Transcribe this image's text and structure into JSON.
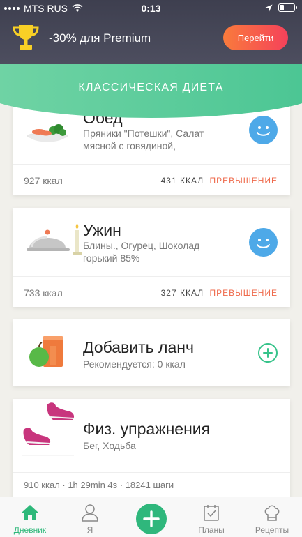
{
  "status": {
    "carrier": "MTS RUS",
    "time": "0:13"
  },
  "promo": {
    "text": "-30% для Premium",
    "button": "Перейти"
  },
  "header": {
    "title": "КЛАССИЧЕСКАЯ ДИЕТА"
  },
  "meals": [
    {
      "title": "Обед",
      "items": "Пряники \"Потешки\", Салат мясной с говядиной,",
      "kcal": "927 ккал",
      "over_value": "431 ККАЛ",
      "over_label": "ПРЕВЫШЕНИЕ"
    },
    {
      "title": "Ужин",
      "items": "Блины., Огурец, Шоколад горький 85%",
      "kcal": "733 ккал",
      "over_value": "327 ККАЛ",
      "over_label": "ПРЕВЫШЕНИЕ"
    }
  ],
  "lunch": {
    "title": "Добавить ланч",
    "recommend": "Рекомендуется: 0  ккал"
  },
  "exercise": {
    "title": "Физ. упражнения",
    "types": "Бег, Ходьба",
    "summary": "910 ккал · 1h 29min 4s  · 18241 шаги"
  },
  "tabs": [
    {
      "label": "Дневник",
      "icon": "home-icon",
      "active": true
    },
    {
      "label": "Я",
      "icon": "person-icon"
    },
    {
      "label": "",
      "icon": "plus-icon"
    },
    {
      "label": "Планы",
      "icon": "calendar-check-icon"
    },
    {
      "label": "Рецепты",
      "icon": "chef-hat-icon"
    }
  ],
  "colors": {
    "accent": "#2fb77c",
    "warning": "#ef6a4b",
    "smiley": "#4ea9e8",
    "promo_gradient_start": "#f97b3c",
    "promo_gradient_end": "#f5415a"
  }
}
